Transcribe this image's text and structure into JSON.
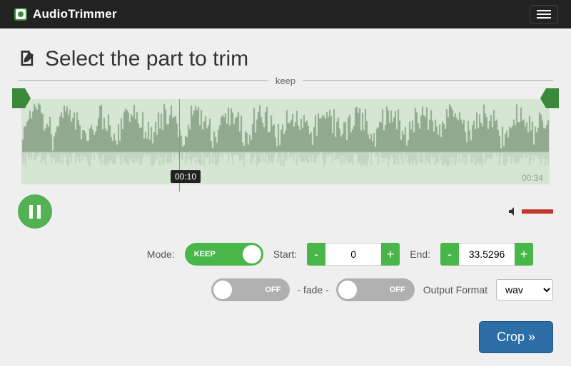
{
  "brand": "AudioTrimmer",
  "heading": "Select the part to trim",
  "rule_label": "keep",
  "playhead_time": "00:10",
  "duration": "00:34",
  "mode": {
    "label": "Mode:",
    "value": "KEEP"
  },
  "start": {
    "label": "Start:",
    "value": "0"
  },
  "end": {
    "label": "End:",
    "value": "33.5296"
  },
  "fade_in": {
    "value": "OFF"
  },
  "fade_out": {
    "value": "OFF"
  },
  "fade_separator": "- fade -",
  "output": {
    "label": "Output Format",
    "value": "wav"
  },
  "crop_label": "Crop »",
  "colors": {
    "accent": "#49b649",
    "nav": "#222",
    "crop": "#2d6ea6"
  }
}
